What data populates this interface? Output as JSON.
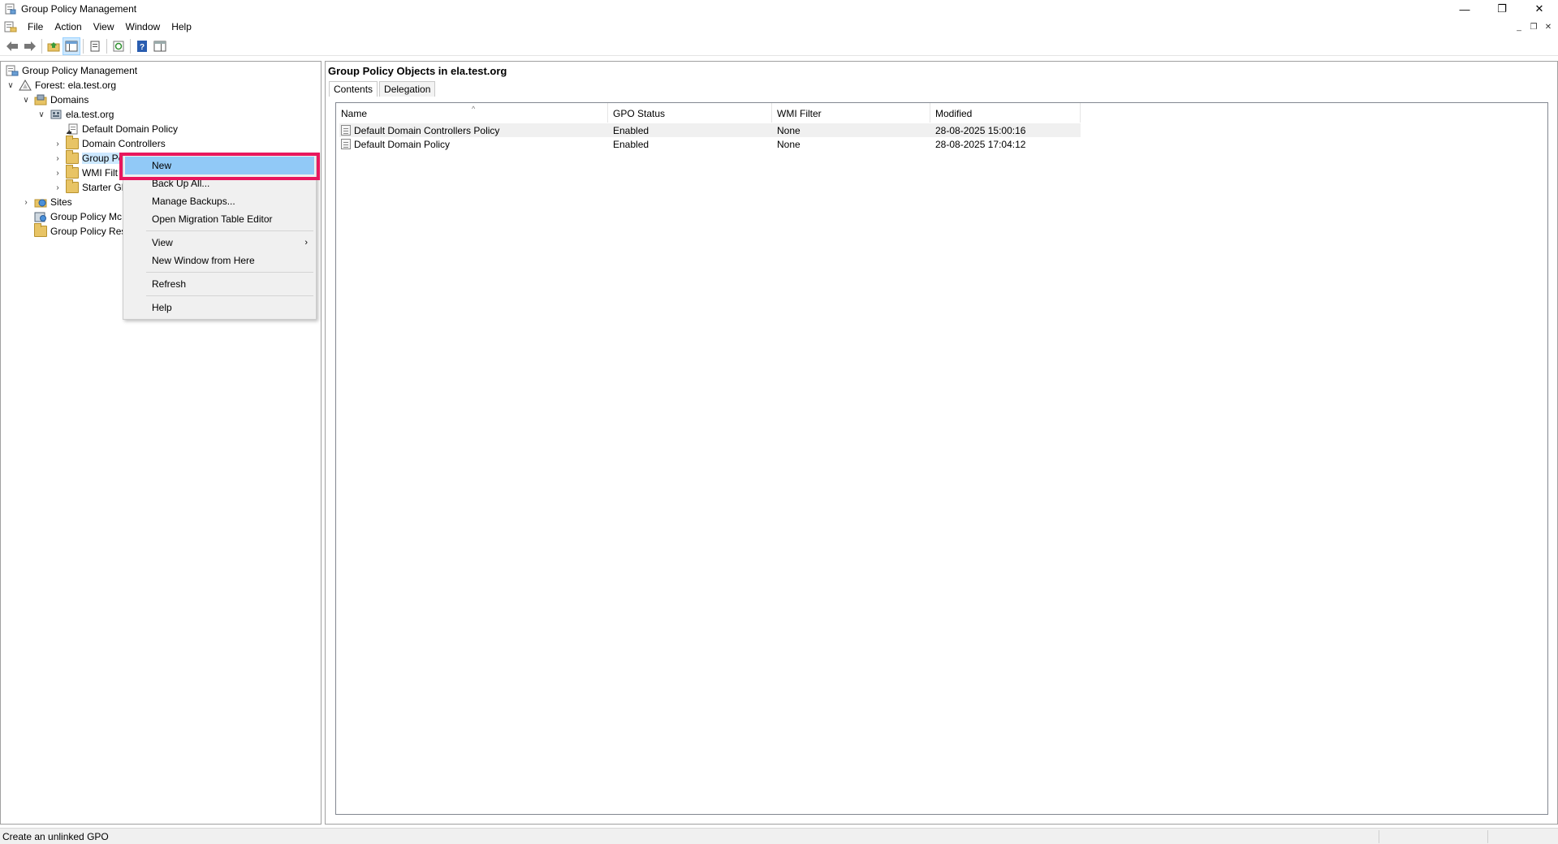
{
  "window": {
    "title": "Group Policy Management",
    "minimize_glyph": "—",
    "restore_glyph": "❐",
    "close_glyph": "✕"
  },
  "menubar": {
    "items": [
      "File",
      "Action",
      "View",
      "Window",
      "Help"
    ]
  },
  "mdi": {
    "minimize_glyph": "_",
    "restore_glyph": "❐",
    "close_glyph": "✕"
  },
  "tree": {
    "root": "Group Policy Management",
    "forest": "Forest: ela.test.org",
    "domains": "Domains",
    "domain": "ela.test.org",
    "default_domain_policy": "Default Domain Policy",
    "domain_controllers": "Domain Controllers",
    "group_policy_objects": "Group Pc",
    "wmi_filters": "WMI Filt",
    "starter_gpos": "Starter GP",
    "sites": "Sites",
    "gp_modeling": "Group Policy Mc",
    "gp_results": "Group Policy Res"
  },
  "right_pane": {
    "title": "Group Policy Objects in ela.test.org",
    "tabs": [
      "Contents",
      "Delegation"
    ],
    "columns": [
      "Name",
      "GPO Status",
      "WMI Filter",
      "Modified"
    ],
    "rows": [
      {
        "name": "Default Domain Controllers Policy",
        "status": "Enabled",
        "wmi": "None",
        "modified": "28-08-2025 15:00:16"
      },
      {
        "name": "Default Domain Policy",
        "status": "Enabled",
        "wmi": "None",
        "modified": "28-08-2025 17:04:12"
      }
    ]
  },
  "context_menu": {
    "items": [
      "New",
      "Back Up All...",
      "Manage Backups...",
      "Open Migration Table Editor",
      "View",
      "New Window from Here",
      "Refresh",
      "Help"
    ],
    "submenu_arrow": "›",
    "highlighted": "New",
    "highlight_color": "#e8175d"
  },
  "status_bar": {
    "text": "Create an unlinked GPO"
  }
}
